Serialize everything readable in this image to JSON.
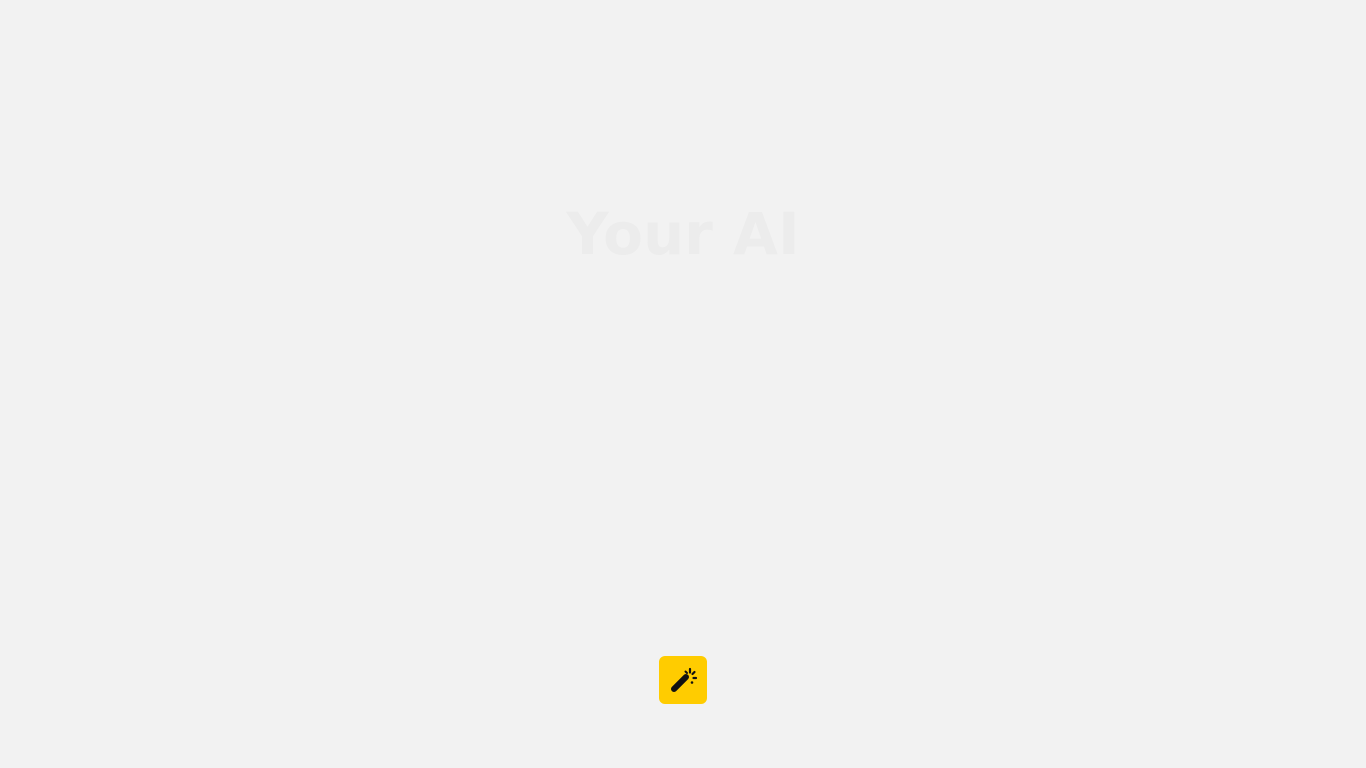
{
  "hero": {
    "title": "Your AI"
  },
  "action": {
    "icon": "magic-wand-icon",
    "accent_color": "#ffcc00"
  }
}
